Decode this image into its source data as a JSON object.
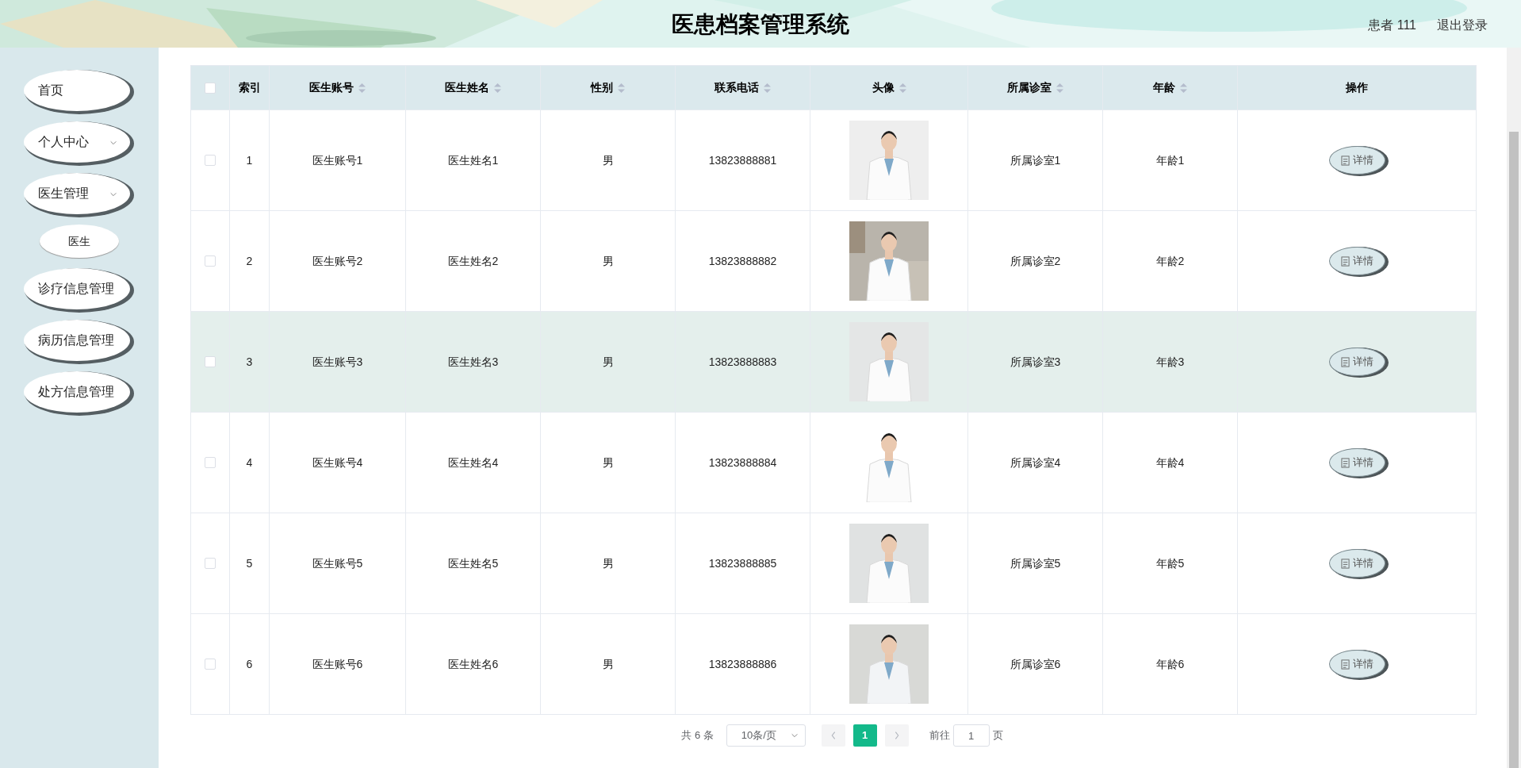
{
  "header": {
    "title": "医患档案管理系统",
    "user": "患者 111",
    "logout": "退出登录"
  },
  "sidebar": {
    "items": [
      {
        "label": "首页",
        "has_arrow": false
      },
      {
        "label": "个人中心",
        "has_arrow": true
      },
      {
        "label": "医生管理",
        "has_arrow": true,
        "children": [
          {
            "label": "医生"
          }
        ]
      },
      {
        "label": "诊疗信息管理",
        "has_arrow": false
      },
      {
        "label": "病历信息管理",
        "has_arrow": false
      },
      {
        "label": "处方信息管理",
        "has_arrow": false
      }
    ]
  },
  "table": {
    "columns": [
      {
        "kind": "checkbox",
        "checked": false
      },
      {
        "kind": "text",
        "label": "索引",
        "sortable": false
      },
      {
        "kind": "text",
        "label": "医生账号",
        "sortable": true
      },
      {
        "kind": "text",
        "label": "医生姓名",
        "sortable": true
      },
      {
        "kind": "text",
        "label": "性别",
        "sortable": true
      },
      {
        "kind": "text",
        "label": "联系电话",
        "sortable": true
      },
      {
        "label": "头像",
        "sortable": true
      },
      {
        "kind": "text",
        "label": "所属诊室",
        "sortable": true
      },
      {
        "kind": "text",
        "label": "年龄",
        "sortable": true
      },
      {
        "kind": "action",
        "label": "操作",
        "sortable": false
      }
    ],
    "rows": [
      {
        "checked": false,
        "highlighted": false,
        "index": "1",
        "account": "医生账号1",
        "name": "医生姓名1",
        "gender": "男",
        "phone": "13823888881",
        "room": "所属诊室1",
        "age": "年龄1",
        "action": "详情"
      },
      {
        "checked": false,
        "highlighted": false,
        "index": "2",
        "account": "医生账号2",
        "name": "医生姓名2",
        "gender": "男",
        "phone": "13823888882",
        "room": "所属诊室2",
        "age": "年龄2",
        "action": "详情"
      },
      {
        "checked": false,
        "highlighted": true,
        "index": "3",
        "account": "医生账号3",
        "name": "医生姓名3",
        "gender": "男",
        "phone": "13823888883",
        "room": "所属诊室3",
        "age": "年龄3",
        "action": "详情"
      },
      {
        "checked": false,
        "highlighted": false,
        "index": "4",
        "account": "医生账号4",
        "name": "医生姓名4",
        "gender": "男",
        "phone": "13823888884",
        "room": "所属诊室4",
        "age": "年龄4",
        "action": "详情"
      },
      {
        "checked": false,
        "highlighted": false,
        "index": "5",
        "account": "医生账号5",
        "name": "医生姓名5",
        "gender": "男",
        "phone": "13823888885",
        "room": "所属诊室5",
        "age": "年龄5",
        "action": "详情"
      },
      {
        "checked": false,
        "highlighted": false,
        "index": "6",
        "account": "医生账号6",
        "name": "医生姓名6",
        "gender": "男",
        "phone": "13823888886",
        "room": "所属诊室6",
        "age": "年龄6",
        "action": "详情"
      }
    ]
  },
  "pagination": {
    "total": "共 6 条",
    "page_size": "10条/页",
    "pages": [
      {
        "label": "1",
        "selected": true
      }
    ],
    "goto_label": "前往",
    "goto_value": "1",
    "page_suffix": "页"
  }
}
